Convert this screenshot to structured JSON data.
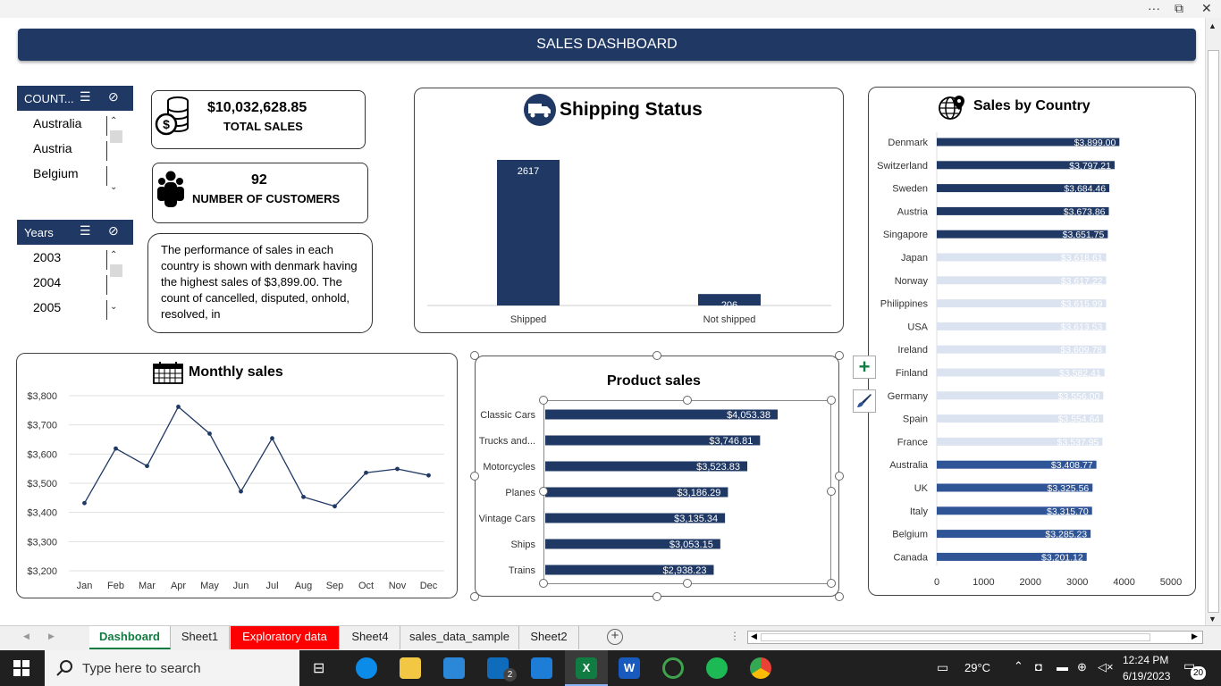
{
  "window": {
    "more": "···",
    "restore": "⧉",
    "close": "✕"
  },
  "dashboard": {
    "title": "SALES DASHBOARD",
    "slicers": {
      "country": {
        "header": "COUNT...",
        "items": [
          "Australia",
          "Austria",
          "Belgium"
        ]
      },
      "years": {
        "header": "Years",
        "items": [
          "2003",
          "2004",
          "2005"
        ]
      }
    },
    "kpis": {
      "total_sales": {
        "value": "$10,032,628.85",
        "label": "TOTAL SALES"
      },
      "customers": {
        "value": "92",
        "label": "NUMBER OF CUSTOMERS"
      }
    },
    "note": "The performance of sales in each country is shown with denmark having the highest sales of $3,899.00. The count of cancelled, disputed, onhold, resolved, in"
  },
  "chart_data": [
    {
      "id": "shipping",
      "type": "bar",
      "title": "Shipping Status",
      "categories": [
        "Shipped",
        "Not shipped"
      ],
      "values": [
        2617,
        206
      ],
      "data_labels": [
        "2617",
        "206"
      ],
      "color": "#1f3864"
    },
    {
      "id": "country",
      "type": "bar",
      "orientation": "horizontal",
      "title": "Sales by Country",
      "categories": [
        "Denmark",
        "Switzerland",
        "Sweden",
        "Austria",
        "Singapore",
        "Japan",
        "Norway",
        "Philippines",
        "USA",
        "Ireland",
        "Finland",
        "Germany",
        "Spain",
        "France",
        "Australia",
        "UK",
        "Italy",
        "Belgium",
        "Canada"
      ],
      "values": [
        3899.0,
        3797.21,
        3684.46,
        3673.86,
        3651.75,
        3618.61,
        3617.22,
        3615.99,
        3613.53,
        3609.78,
        3582.41,
        3556.0,
        3554.64,
        3537.95,
        3408.77,
        3325.56,
        3315.7,
        3285.23,
        3201.12
      ],
      "data_labels": [
        "$3,899.00",
        "$3,797.21",
        "$3,684.46",
        "$3,673.86",
        "$3,651.75",
        "$3,618.61",
        "$3,617.22",
        "$3,615.99",
        "$3,613.53",
        "$3,609.78",
        "$3,582.41",
        "$3,556.00",
        "$3,554.64",
        "$3,537.95",
        "$3,408.77",
        "$3,325.56",
        "$3,315.70",
        "$3,285.23",
        "$3,201.12"
      ],
      "bar_colors": [
        "#1f3864",
        "#1f3864",
        "#1f3864",
        "#1f3864",
        "#1f3864",
        "#dce3f0",
        "#dce3f0",
        "#dce3f0",
        "#dce3f0",
        "#dce3f0",
        "#dce3f0",
        "#dce3f0",
        "#dce3f0",
        "#dce3f0",
        "#2f5597",
        "#2f5597",
        "#2f5597",
        "#2f5597",
        "#2f5597"
      ],
      "x_ticks": [
        "0",
        "1000",
        "2000",
        "3000",
        "4000",
        "5000"
      ],
      "xlim": [
        0,
        5000
      ]
    },
    {
      "id": "monthly",
      "type": "line",
      "title": "Monthly sales",
      "x": [
        "Jan",
        "Feb",
        "Mar",
        "Apr",
        "May",
        "Jun",
        "Jul",
        "Aug",
        "Sep",
        "Oct",
        "Nov",
        "Dec"
      ],
      "values": [
        3432,
        3619,
        3559,
        3762,
        3670,
        3472,
        3654,
        3453,
        3421,
        3536,
        3549,
        3527
      ],
      "y_ticks": [
        "$3,800",
        "$3,700",
        "$3,600",
        "$3,500",
        "$3,400",
        "$3,300",
        "$3,200"
      ],
      "ylim": [
        3200,
        3800
      ],
      "color": "#1f3864"
    },
    {
      "id": "product",
      "type": "bar",
      "orientation": "horizontal",
      "title": "Product sales",
      "categories": [
        "Classic Cars",
        "Trucks and...",
        "Motorcycles",
        "Planes",
        "Vintage Cars",
        "Ships",
        "Trains"
      ],
      "values": [
        4053.38,
        3746.81,
        3523.83,
        3186.29,
        3135.34,
        3053.15,
        2938.23
      ],
      "data_labels": [
        "$4,053.38",
        "$3,746.81",
        "$3,523.83",
        "$3,186.29",
        "$3,135.34",
        "$3,053.15",
        "$2,938.23"
      ],
      "color": "#1f3864"
    }
  ],
  "sheet_tabs": [
    {
      "label": "Dashboard",
      "active": true
    },
    {
      "label": "Sheet1"
    },
    {
      "label": "Exploratory data",
      "highlight": "#ff0000"
    },
    {
      "label": "Sheet4"
    },
    {
      "label": "sales_data_sample"
    },
    {
      "label": "Sheet2"
    }
  ],
  "taskbar": {
    "search_placeholder": "Type here to search",
    "weather": "29°C",
    "time": "12:24 PM",
    "date": "6/19/2023",
    "notifications": "20",
    "mail_badge": "2"
  }
}
